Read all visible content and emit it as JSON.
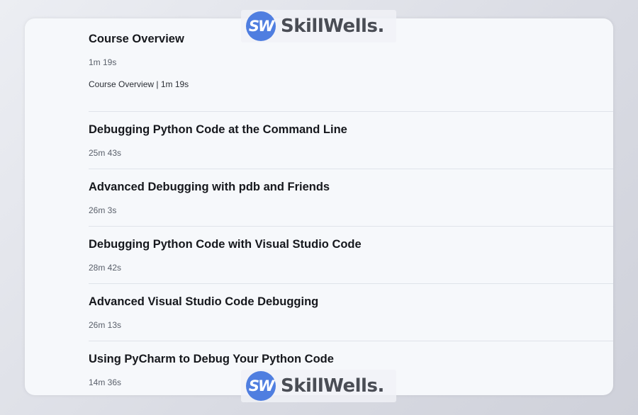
{
  "watermark": {
    "logo_text": "SW",
    "brand_text": "SkillWells."
  },
  "modules": [
    {
      "title": "Course Overview",
      "duration": "1m 19s",
      "clips": [
        {
          "label": "Course Overview | 1m 19s"
        }
      ]
    },
    {
      "title": "Debugging Python Code at the Command Line",
      "duration": "25m 43s"
    },
    {
      "title": "Advanced Debugging with pdb and Friends",
      "duration": "26m 3s"
    },
    {
      "title": "Debugging Python Code with Visual Studio Code",
      "duration": "28m 42s"
    },
    {
      "title": "Advanced Visual Studio Code Debugging",
      "duration": "26m 13s"
    },
    {
      "title": "Using PyCharm to Debug Your Python Code",
      "duration": "14m 36s"
    }
  ],
  "colors": {
    "card_background": "#f6f8fb",
    "title_text": "#16181d",
    "duration_text": "#5a606b",
    "divider": "#dfe3ea",
    "logo_blue": "#4f7ee0"
  }
}
